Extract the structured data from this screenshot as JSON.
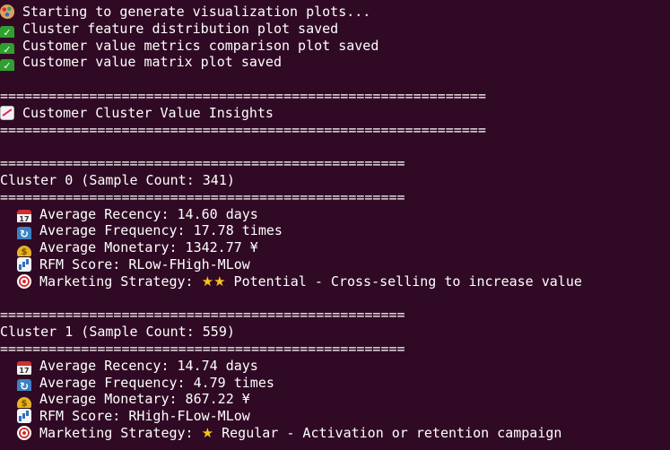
{
  "progress": [
    {
      "icon": "palette-icon",
      "text": "Starting to generate visualization plots..."
    },
    {
      "icon": "check-mark-icon",
      "text": "Cluster feature distribution plot saved"
    },
    {
      "icon": "check-mark-icon",
      "text": "Customer value metrics comparison plot saved"
    },
    {
      "icon": "check-mark-icon",
      "text": "Customer value matrix plot saved"
    }
  ],
  "insights": {
    "separator": "============================================================",
    "heading": "Customer Cluster Value Insights"
  },
  "cluster_separator": "==================================================",
  "clusters": [
    {
      "header": "Cluster 0 (Sample Count: 341)",
      "recency": "Average Recency: 14.60 days",
      "frequency": "Average Frequency: 17.78 times",
      "monetary": "Average Monetary: 1342.77 ¥",
      "rfm": "RFM Score: RLow-FHigh-MLow",
      "strategy_label": "Marketing Strategy: ",
      "strategy_stars": "★★",
      "strategy_text": " Potential - Cross-selling to increase value"
    },
    {
      "header": "Cluster 1 (Sample Count: 559)",
      "recency": "Average Recency: 14.74 days",
      "frequency": "Average Frequency: 4.79 times",
      "monetary": "Average Monetary: 867.22 ¥",
      "rfm": "RFM Score: RHigh-FLow-MLow",
      "strategy_label": "Marketing Strategy: ",
      "strategy_stars": "★",
      "strategy_text": " Regular - Activation or retention campaign"
    }
  ]
}
